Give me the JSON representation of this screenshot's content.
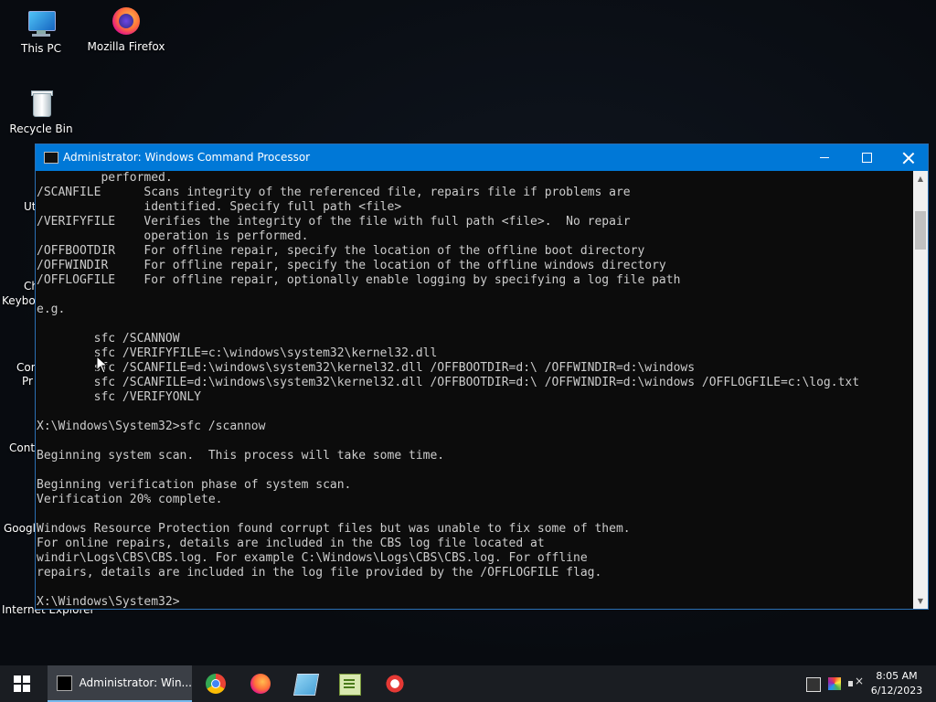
{
  "desktop": {
    "icons": [
      {
        "label": "This PC"
      },
      {
        "label": "Mozilla Firefox"
      },
      {
        "label": "Recycle Bin"
      }
    ],
    "partial_labels": [
      "Ut",
      "Ch",
      "Keyboa",
      "Con",
      "Pr",
      "Contr",
      "Googl",
      "Internet Explorer"
    ]
  },
  "window": {
    "title": "Administrator: Windows Command Processor",
    "console_text": "         performed.\n/SCANFILE      Scans integrity of the referenced file, repairs file if problems are\n               identified. Specify full path <file>\n/VERIFYFILE    Verifies the integrity of the file with full path <file>.  No repair\n               operation is performed.\n/OFFBOOTDIR    For offline repair, specify the location of the offline boot directory\n/OFFWINDIR     For offline repair, specify the location of the offline windows directory\n/OFFLOGFILE    For offline repair, optionally enable logging by specifying a log file path\n\ne.g.\n\n        sfc /SCANNOW\n        sfc /VERIFYFILE=c:\\windows\\system32\\kernel32.dll\n        sfc /SCANFILE=d:\\windows\\system32\\kernel32.dll /OFFBOOTDIR=d:\\ /OFFWINDIR=d:\\windows\n        sfc /SCANFILE=d:\\windows\\system32\\kernel32.dll /OFFBOOTDIR=d:\\ /OFFWINDIR=d:\\windows /OFFLOGFILE=c:\\log.txt\n        sfc /VERIFYONLY\n\nX:\\Windows\\System32>sfc /scannow\n\nBeginning system scan.  This process will take some time.\n\nBeginning verification phase of system scan.\nVerification 20% complete.\n\nWindows Resource Protection found corrupt files but was unable to fix some of them.\nFor online repairs, details are included in the CBS log file located at\nwindir\\Logs\\CBS\\CBS.log. For example C:\\Windows\\Logs\\CBS\\CBS.log. For offline\nrepairs, details are included in the log file provided by the /OFFLOGFILE flag.\n\nX:\\Windows\\System32>"
  },
  "taskbar": {
    "active_app_label": "Administrator: Win...",
    "pinned_icons": [
      "chrome-icon",
      "firefox-icon",
      "notepad-icon",
      "notepad-plus-plus-icon",
      "paint-icon"
    ],
    "tray_icons": [
      "network-icon",
      "color-icon",
      "volume-muted-icon"
    ],
    "time": "8:05 AM",
    "date": "6/12/2023"
  },
  "colors": {
    "titlebar": "#0078d7",
    "console_bg": "#0c0c0c",
    "console_fg": "#cccccc",
    "taskbar": "#1a1d22"
  }
}
